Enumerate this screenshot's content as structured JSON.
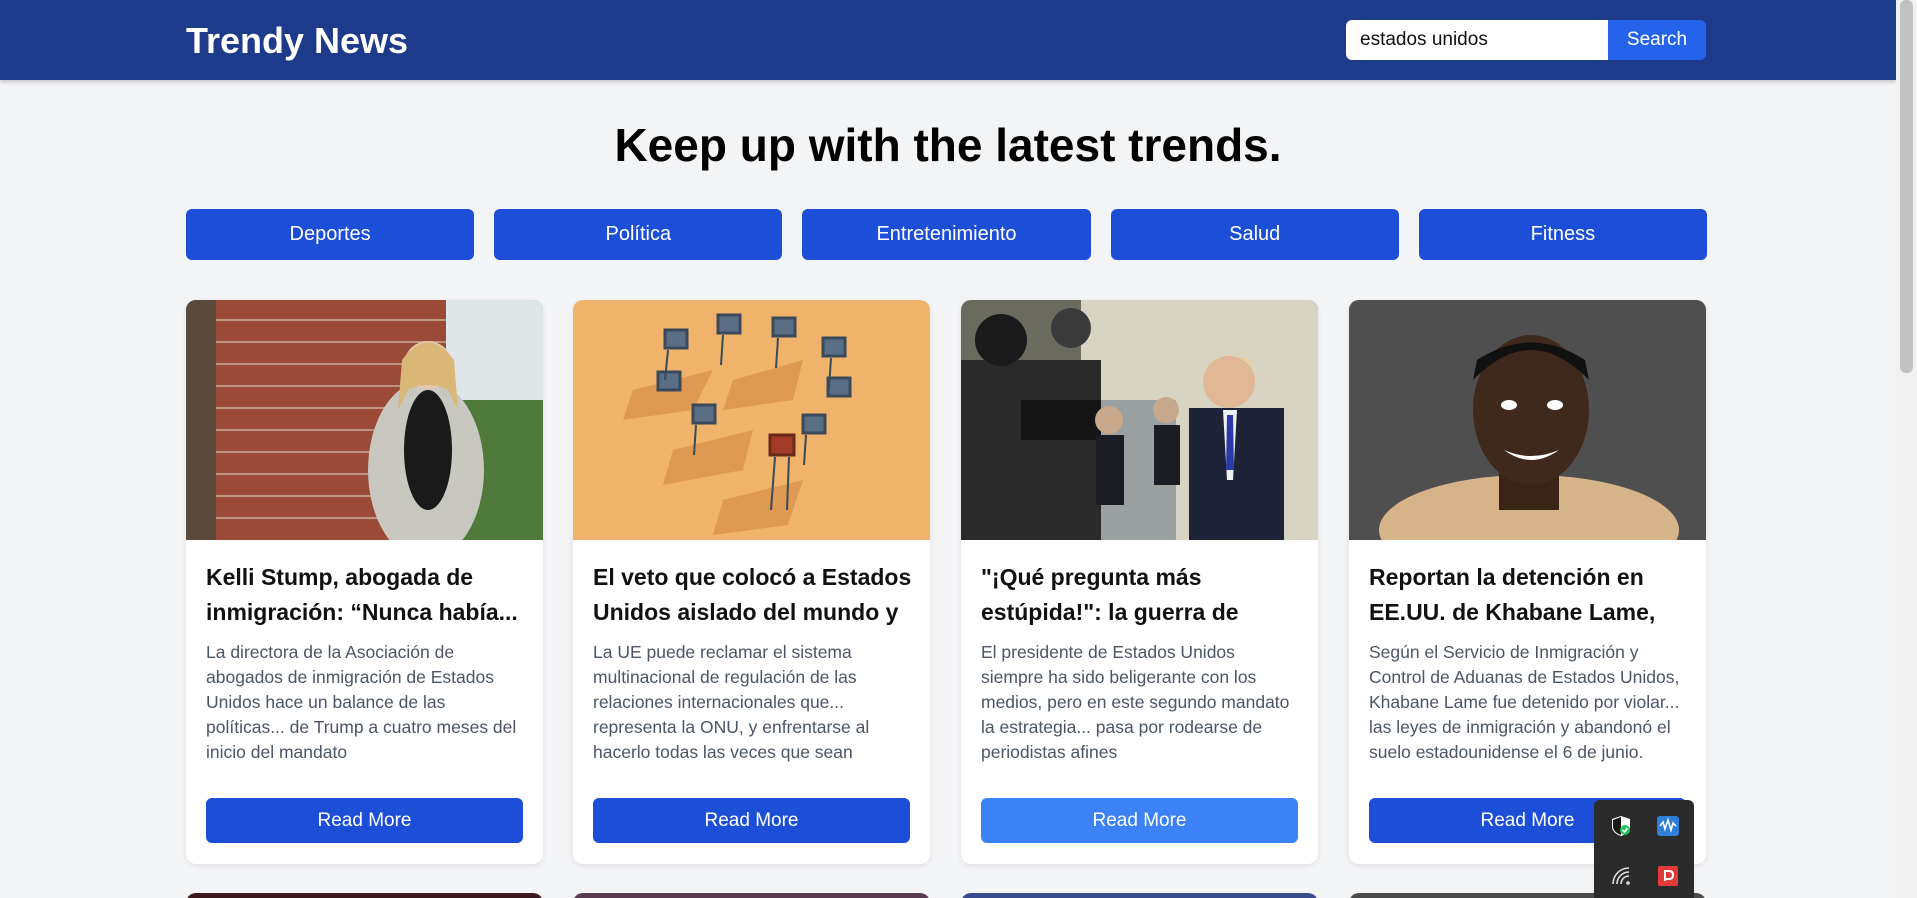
{
  "header": {
    "brand": "Trendy News",
    "search_value": "estados unidos",
    "search_label": "Search"
  },
  "hero": {
    "headline": "Keep up with the latest trends."
  },
  "categories": [
    "Deportes",
    "Política",
    "Entretenimiento",
    "Salud",
    "Fitness"
  ],
  "articles": [
    {
      "title": "Kelli Stump, abogada de inmigración: “Nunca había...",
      "description": "La directora de la Asociación de abogados de inmigración de Estados Unidos hace un balance de las políticas... de Trump a cuatro meses del inicio del mandato",
      "button": "Read More"
    },
    {
      "title": "El veto que colocó a Estados Unidos aislado del mundo y ...",
      "description": "La UE puede reclamar el sistema multinacional de regulación de las relaciones internacionales que... representa la ONU, y enfrentarse al hacerlo todas las veces que sean necesarias al gobierno de Trump",
      "button": "Read More"
    },
    {
      "title": "\"¡Qué pregunta más estúpida!\": la guerra de Trum...",
      "description": "El presidente de Estados Unidos siempre ha sido beligerante con los medios, pero en este segundo mandato la estrategia... pasa por rodearse de periodistas afines",
      "button": "Read More"
    },
    {
      "title": "Reportan la detención en EE.UU. de Khabane Lame, la...",
      "description": "Según el Servicio de Inmigración y Control de Aduanas de Estados Unidos, Khabane Lame fue detenido por violar... las leyes de inmigración y abandonó el suelo estadounidense el 6 de junio.",
      "button": "Read More"
    }
  ],
  "colors": {
    "header": "#1e3a8a",
    "accent": "#1d4ed8",
    "accent_light": "#3b82f6",
    "background": "#f3f4f6"
  },
  "tray": {
    "icons": [
      "shield-check-icon",
      "audio-wave-icon",
      "wifi-icon",
      "pdf-reader-icon"
    ]
  }
}
